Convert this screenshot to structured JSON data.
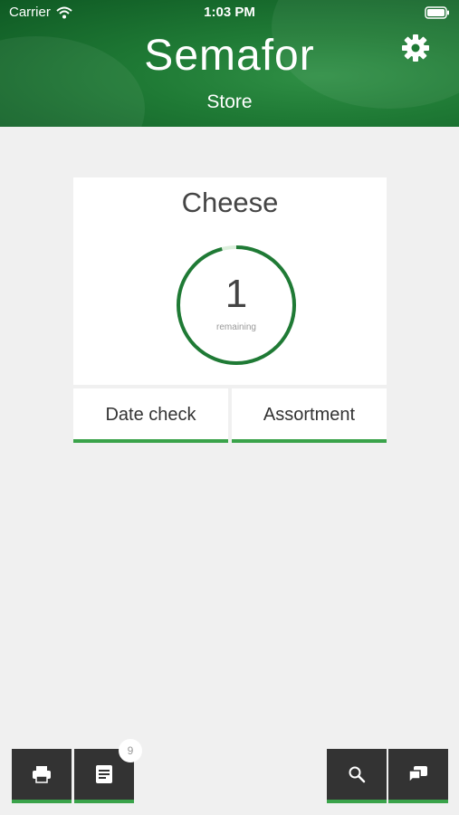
{
  "status_bar": {
    "carrier": "Carrier",
    "time": "1:03 PM"
  },
  "header": {
    "title": "Semafor",
    "subtitle": "Store"
  },
  "card": {
    "title": "Cheese",
    "count": "1",
    "count_label": "remaining",
    "progress": 0.96
  },
  "tabs": {
    "date_check": "Date check",
    "assortment": "Assortment"
  },
  "bottom_bar": {
    "notes_badge": "9"
  },
  "colors": {
    "brand_green": "#1f7a35",
    "accent_green": "#3aa34a",
    "button_dark": "#333333"
  }
}
